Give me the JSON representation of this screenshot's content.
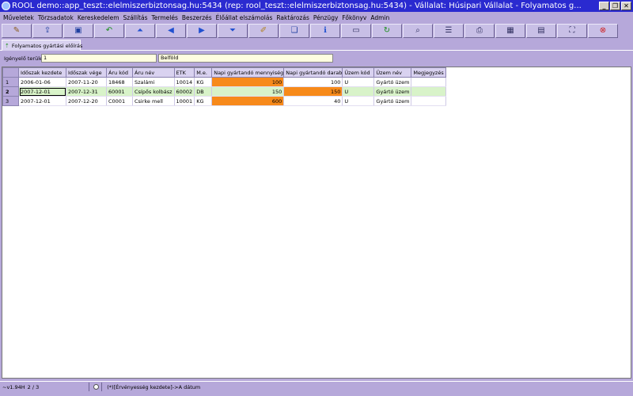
{
  "window": {
    "title": "ROOL demo::app_teszt::elelmiszerbiztonsag.hu:5434 (rep: rool_teszt::elelmiszerbiztonsag.hu:5434) - Vállalat: Húsipari Vállalat - Folyamatos g...",
    "minimize": "_",
    "restore": "❐",
    "close": "✕"
  },
  "menu": [
    "Műveletek",
    "Törzsadatok",
    "Kereskedelem",
    "Szállítás",
    "Termelés",
    "Beszerzés",
    "Élőállat elszámolás",
    "Raktározás",
    "Pénzügy",
    "Főkönyv",
    "Admin"
  ],
  "toolbar": [
    {
      "icon": "tools-icon",
      "glyph": "✎",
      "color": "#8a5a1a"
    },
    {
      "icon": "open-icon",
      "glyph": "⇪",
      "color": "#2040a0"
    },
    {
      "icon": "save-icon",
      "glyph": "▣",
      "color": "#2040a0"
    },
    {
      "icon": "undo-icon",
      "glyph": "↶",
      "color": "#1a8f1a"
    },
    {
      "icon": "first-icon",
      "glyph": "⏶",
      "color": "#2050d0"
    },
    {
      "icon": "prev-icon",
      "glyph": "◀",
      "color": "#2050d0"
    },
    {
      "icon": "next-icon",
      "glyph": "▶",
      "color": "#2050d0"
    },
    {
      "icon": "last-icon",
      "glyph": "⏷",
      "color": "#2050d0"
    },
    {
      "icon": "edit-icon",
      "glyph": "✐",
      "color": "#b08020"
    },
    {
      "icon": "copy-icon",
      "glyph": "❏",
      "color": "#2040a0"
    },
    {
      "icon": "info-icon",
      "glyph": "ℹ",
      "color": "#2050d0"
    },
    {
      "icon": "window-icon",
      "glyph": "▭",
      "color": "#303060"
    },
    {
      "icon": "refresh-icon",
      "glyph": "↻",
      "color": "#1a8f1a"
    },
    {
      "icon": "search-icon",
      "glyph": "⌕",
      "color": "#303060"
    },
    {
      "icon": "list-icon",
      "glyph": "☰",
      "color": "#303060"
    },
    {
      "icon": "print-icon",
      "glyph": "⎙",
      "color": "#303060"
    },
    {
      "icon": "grid-icon",
      "glyph": "▦",
      "color": "#303060"
    },
    {
      "icon": "grid-export-icon",
      "glyph": "▤",
      "color": "#303060"
    },
    {
      "icon": "fullscreen-icon",
      "glyph": "⛶",
      "color": "#303060"
    },
    {
      "icon": "exit-icon",
      "glyph": "⊗",
      "color": "#d02020"
    }
  ],
  "tab": {
    "label": "Folyamatos gyártási előírás"
  },
  "filter": {
    "label": "Igényelő terület:",
    "code": "1",
    "name": "Belföld"
  },
  "grid": {
    "columns": [
      "Időszak kezdete",
      "Időszak vége",
      "Áru kód",
      "Áru név",
      "ETK",
      "M.e.",
      "Napi gyártandó mennyiség",
      "Napi gyártandó darab",
      "Üzem kód",
      "Üzem név",
      "Megjegyzés"
    ],
    "rows": [
      {
        "num": "1",
        "start": "2006-01-06",
        "end": "2007-11-20",
        "code": "18468",
        "name": "Szalámi",
        "etk": "10014",
        "unit": "KG",
        "qty": "100",
        "pcs": "100",
        "plant_code": "U",
        "plant_name": "Gyártó üzem",
        "note": ""
      },
      {
        "num": "2",
        "start": "2007-12-01",
        "end": "2007-12-31",
        "code": "60001",
        "name": "Csípős kolbász",
        "etk": "60002",
        "unit": "DB",
        "qty": "150",
        "pcs": "150",
        "plant_code": "U",
        "plant_name": "Gyártó üzem",
        "note": ""
      },
      {
        "num": "3",
        "start": "2007-12-01",
        "end": "2007-12-20",
        "code": "C0001",
        "name": "Csirke mell",
        "etk": "10001",
        "unit": "KG",
        "qty": "600",
        "pcs": "40",
        "plant_code": "U",
        "plant_name": "Gyártó üzem",
        "note": ""
      }
    ],
    "highlight_color": "#f78a1a",
    "selected_row_color": "#d8f3c9"
  },
  "status": {
    "version": "~v1.94H",
    "position": "2 / 3",
    "hint": "(*)[Érvényesség kezdete]->A dátum"
  }
}
